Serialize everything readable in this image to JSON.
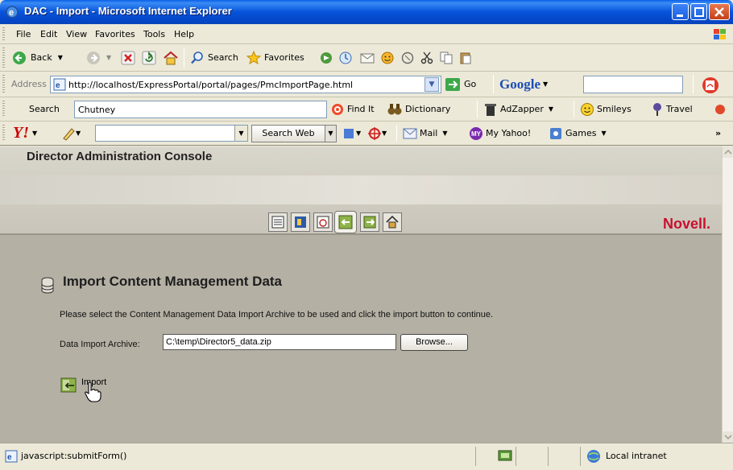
{
  "window": {
    "title": "DAC - Import - Microsoft Internet Explorer"
  },
  "menu": [
    "File",
    "Edit",
    "View",
    "Favorites",
    "Tools",
    "Help"
  ],
  "toolbar": {
    "back": "Back",
    "search": "Search",
    "favorites": "Favorites"
  },
  "address": {
    "label": "Address",
    "url": "http://localhost/ExpressPortal/portal/pages/PmcImportPage.html",
    "go": "Go",
    "google": "Google"
  },
  "searchbar": {
    "label": "Search",
    "value": "Chutney",
    "find_it": "Find It",
    "dictionary": "Dictionary",
    "adzapper": "AdZapper",
    "smileys": "Smileys",
    "travel": "Travel"
  },
  "yahoo": {
    "search_web": "Search Web",
    "mail": "Mail",
    "my_yahoo": "My Yahoo!",
    "games": "Games",
    "more": "»"
  },
  "dac": {
    "console_title": "Director Administration Console",
    "brand": "Novell.",
    "page_title": "Import Content Management Data",
    "instructions": "Please select the Content Management Data Import Archive to be used and click the import button to continue.",
    "archive_label": "Data Import Archive:",
    "archive_value": "C:\\temp\\Director5_data.zip",
    "browse_label": "Browse...",
    "import_label": "Import"
  },
  "status": {
    "text": "javascript:submitForm()",
    "zone": "Local intranet"
  },
  "colors": {
    "titlebar": "#0653DB",
    "content_bg": "#B5B0A4",
    "brand": "#C8102E"
  }
}
